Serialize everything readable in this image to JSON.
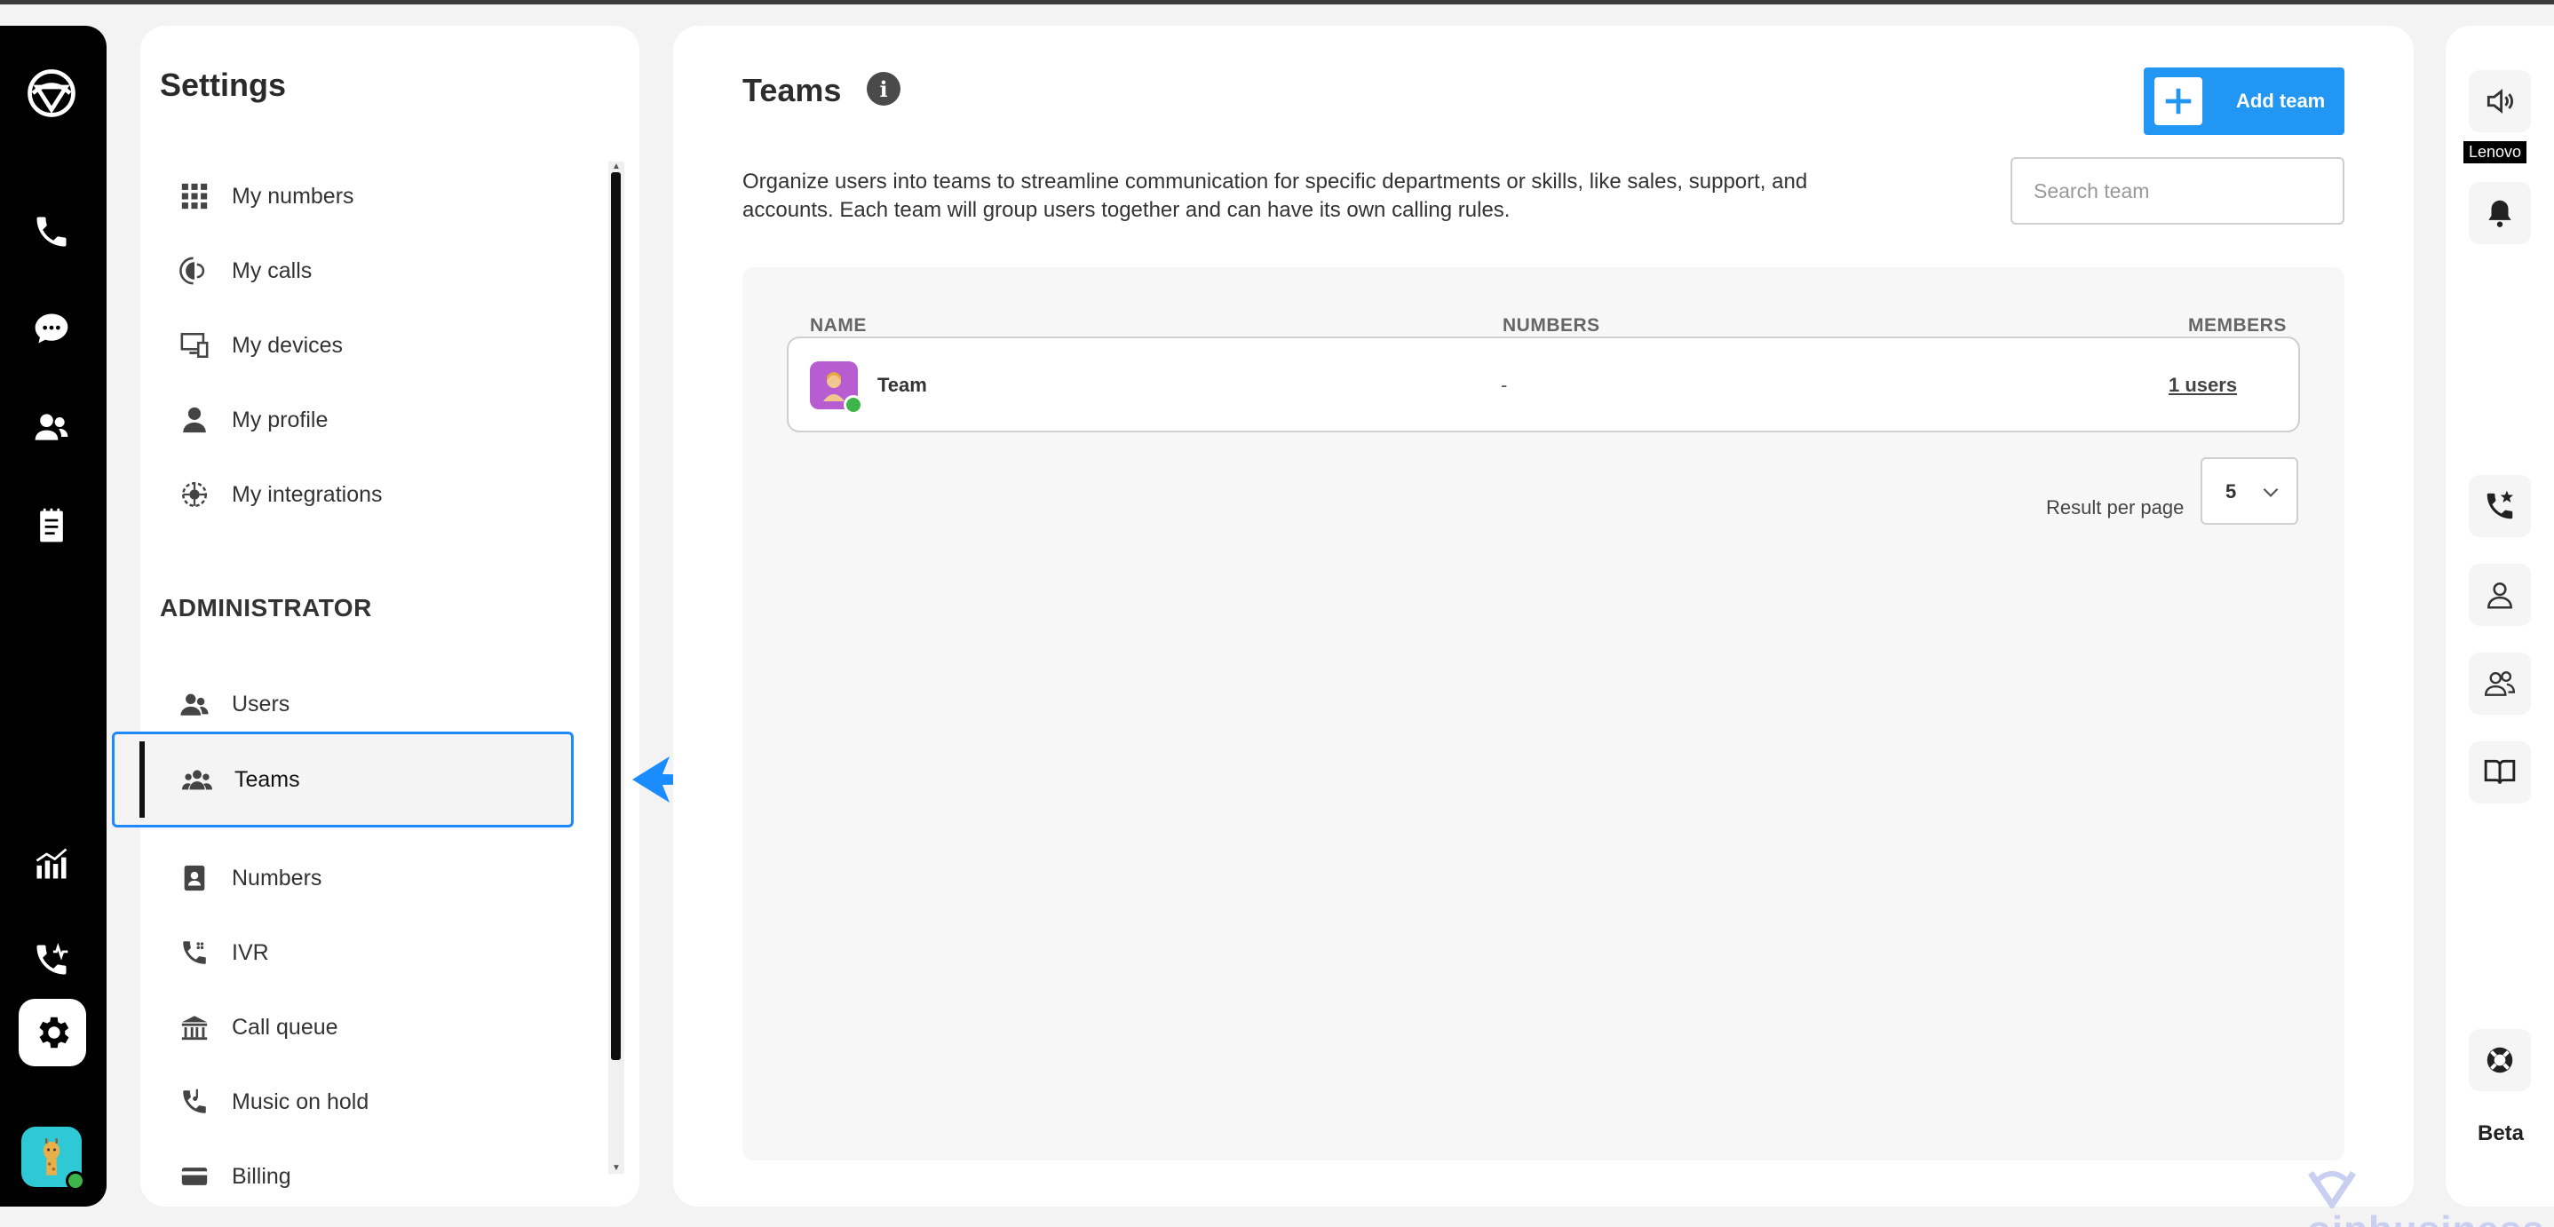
{
  "settings": {
    "title": "Settings",
    "personal_items": [
      {
        "label": "My numbers",
        "icon": "grid-icon"
      },
      {
        "label": "My calls",
        "icon": "phone-wave-icon"
      },
      {
        "label": "My devices",
        "icon": "devices-icon"
      },
      {
        "label": "My profile",
        "icon": "person-icon"
      },
      {
        "label": "My integrations",
        "icon": "integrations-icon"
      }
    ],
    "admin_heading": "ADMINISTRATOR",
    "admin_items": [
      {
        "label": "Users",
        "icon": "users-icon"
      },
      {
        "label": "Teams",
        "icon": "teams-icon",
        "active": true
      },
      {
        "label": "Numbers",
        "icon": "contact-book-icon"
      },
      {
        "label": "IVR",
        "icon": "ivr-icon"
      },
      {
        "label": "Call queue",
        "icon": "call-queue-icon"
      },
      {
        "label": "Music on hold",
        "icon": "music-on-hold-icon"
      },
      {
        "label": "Billing",
        "icon": "billing-icon"
      }
    ]
  },
  "main": {
    "title": "Teams",
    "add_button_label": "Add team",
    "description": "Organize users into teams to streamline communication for specific departments or skills, like sales, support, and accounts. Each team will group users together and can have its own calling rules.",
    "search_placeholder": "Search team",
    "columns": {
      "name": "NAME",
      "numbers": "NUMBERS",
      "members": "MEMBERS"
    },
    "rows": [
      {
        "name": "Team",
        "numbers": "-",
        "members": "1 users"
      }
    ],
    "result_per_page_label": "Result per page",
    "result_per_page_value": "5"
  },
  "right_rail": {
    "device_tag": "Lenovo",
    "beta_label": "Beta"
  },
  "watermark": "oipbusiness",
  "colors": {
    "accent": "#2196f3",
    "highlight_border": "#1e88ff",
    "online": "#3db54a",
    "rail_bg": "#000000"
  }
}
